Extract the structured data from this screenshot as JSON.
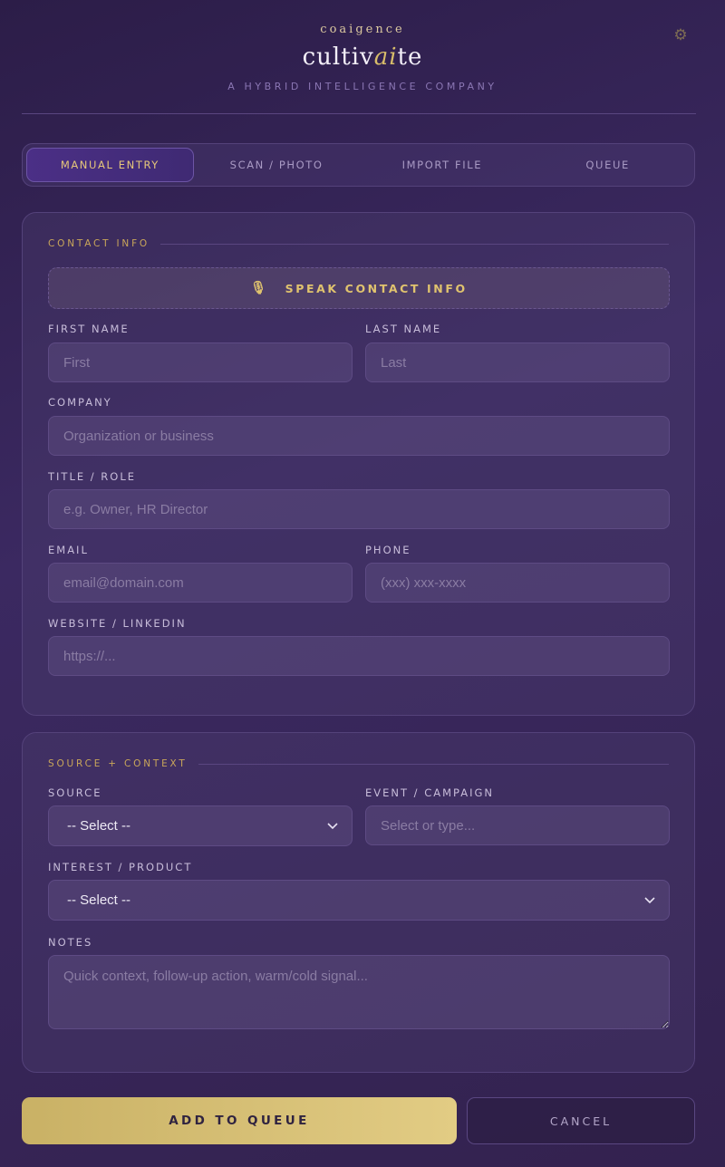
{
  "brand": {
    "small": "coaigence",
    "main_prefix": "cultiv",
    "main_accent": "ai",
    "main_suffix": "te",
    "tagline": "A HYBRID INTELLIGENCE COMPANY"
  },
  "settings_icon": "gear-icon",
  "tabs": [
    {
      "label": "MANUAL ENTRY",
      "active": true
    },
    {
      "label": "SCAN / PHOTO",
      "active": false
    },
    {
      "label": "IMPORT FILE",
      "active": false
    },
    {
      "label": "QUEUE",
      "active": false
    }
  ],
  "contact": {
    "section_title": "CONTACT INFO",
    "speak_button": "SPEAK CONTACT INFO",
    "speak_icon": "microphone-icon",
    "first_name": {
      "label": "FIRST NAME",
      "placeholder": "First",
      "value": ""
    },
    "last_name": {
      "label": "LAST NAME",
      "placeholder": "Last",
      "value": ""
    },
    "company": {
      "label": "COMPANY",
      "placeholder": "Organization or business",
      "value": ""
    },
    "title": {
      "label": "TITLE / ROLE",
      "placeholder": "e.g. Owner, HR Director",
      "value": ""
    },
    "email": {
      "label": "EMAIL",
      "placeholder": "email@domain.com",
      "value": ""
    },
    "phone": {
      "label": "PHONE",
      "placeholder": "(xxx) xxx-xxxx",
      "value": ""
    },
    "website": {
      "label": "WEBSITE / LINKEDIN",
      "placeholder": "https://...",
      "value": ""
    }
  },
  "source_context": {
    "section_title": "SOURCE + CONTEXT",
    "source": {
      "label": "SOURCE",
      "selected": "-- Select --"
    },
    "event": {
      "label": "EVENT / CAMPAIGN",
      "placeholder": "Select or type...",
      "value": ""
    },
    "interest": {
      "label": "INTEREST / PRODUCT",
      "selected": "-- Select --"
    },
    "notes": {
      "label": "NOTES",
      "placeholder": "Quick context, follow-up action, warm/cold signal...",
      "value": ""
    }
  },
  "actions": {
    "primary": "ADD TO QUEUE",
    "secondary": "CANCEL"
  },
  "colors": {
    "accent_gold": "#d8bd6a",
    "background": "#33224f",
    "active_tab": "#4b2f86"
  }
}
